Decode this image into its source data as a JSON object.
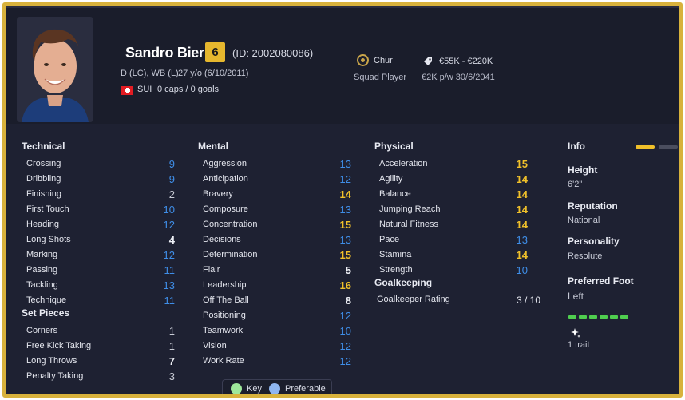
{
  "player": {
    "name": "Sandro Bieri",
    "ca": "6",
    "id_text": "(ID: 2002080086)",
    "positions": "D (LC), WB (L)",
    "age": "27 y/o (6/10/2011)",
    "nationality": "SUI",
    "caps": "0 caps / 0 goals",
    "club": "Chur",
    "squad_status": "Squad Player",
    "value_range": "€55K - €220K",
    "wage_contract": "€2K p/w  30/6/2041"
  },
  "technical": {
    "title": "Technical",
    "items": [
      {
        "label": "Crossing",
        "value": "9",
        "color": "blue"
      },
      {
        "label": "Dribbling",
        "value": "9",
        "color": "blue"
      },
      {
        "label": "Finishing",
        "value": "2",
        "color": "grey"
      },
      {
        "label": "First Touch",
        "value": "10",
        "color": "blue"
      },
      {
        "label": "Heading",
        "value": "12",
        "color": "blue"
      },
      {
        "label": "Long Shots",
        "value": "4",
        "color": "white"
      },
      {
        "label": "Marking",
        "value": "12",
        "color": "blue"
      },
      {
        "label": "Passing",
        "value": "11",
        "color": "blue"
      },
      {
        "label": "Tackling",
        "value": "13",
        "color": "blue"
      },
      {
        "label": "Technique",
        "value": "11",
        "color": "blue"
      }
    ]
  },
  "set_pieces": {
    "title": "Set Pieces",
    "items": [
      {
        "label": "Corners",
        "value": "1",
        "color": "grey"
      },
      {
        "label": "Free Kick Taking",
        "value": "1",
        "color": "grey"
      },
      {
        "label": "Long Throws",
        "value": "7",
        "color": "white"
      },
      {
        "label": "Penalty Taking",
        "value": "3",
        "color": "grey"
      }
    ]
  },
  "mental": {
    "title": "Mental",
    "items": [
      {
        "label": "Aggression",
        "value": "13",
        "color": "blue"
      },
      {
        "label": "Anticipation",
        "value": "12",
        "color": "blue"
      },
      {
        "label": "Bravery",
        "value": "14",
        "color": "yellow"
      },
      {
        "label": "Composure",
        "value": "13",
        "color": "blue"
      },
      {
        "label": "Concentration",
        "value": "15",
        "color": "yellow"
      },
      {
        "label": "Decisions",
        "value": "13",
        "color": "blue"
      },
      {
        "label": "Determination",
        "value": "15",
        "color": "yellow"
      },
      {
        "label": "Flair",
        "value": "5",
        "color": "white"
      },
      {
        "label": "Leadership",
        "value": "16",
        "color": "yellow"
      },
      {
        "label": "Off The Ball",
        "value": "8",
        "color": "white"
      },
      {
        "label": "Positioning",
        "value": "12",
        "color": "blue"
      },
      {
        "label": "Teamwork",
        "value": "10",
        "color": "blue"
      },
      {
        "label": "Vision",
        "value": "12",
        "color": "blue"
      },
      {
        "label": "Work Rate",
        "value": "12",
        "color": "blue"
      }
    ]
  },
  "physical": {
    "title": "Physical",
    "items": [
      {
        "label": "Acceleration",
        "value": "15",
        "color": "yellow"
      },
      {
        "label": "Agility",
        "value": "14",
        "color": "yellow"
      },
      {
        "label": "Balance",
        "value": "14",
        "color": "yellow"
      },
      {
        "label": "Jumping Reach",
        "value": "14",
        "color": "yellow"
      },
      {
        "label": "Natural Fitness",
        "value": "14",
        "color": "yellow"
      },
      {
        "label": "Pace",
        "value": "13",
        "color": "blue"
      },
      {
        "label": "Stamina",
        "value": "14",
        "color": "yellow"
      },
      {
        "label": "Strength",
        "value": "10",
        "color": "blue"
      }
    ]
  },
  "goalkeeping": {
    "title": "Goalkeeping",
    "label": "Goalkeeper Rating",
    "value": "3 / 10"
  },
  "info": {
    "title": "Info",
    "height_label": "Height",
    "height": "6'2\"",
    "reputation_label": "Reputation",
    "reputation": "National",
    "personality_label": "Personality",
    "personality": "Resolute",
    "foot_label": "Preferred Foot",
    "foot": "Left",
    "foot_level": 1.0,
    "traits": "1 trait"
  },
  "legend": {
    "key": "Key",
    "preferable": "Preferable"
  },
  "colors": {
    "border": "#d8b23c",
    "background": "#1e2132",
    "ca_badge": "#e6b72e",
    "attr_blue": "#3f8ee8",
    "attr_yellow": "#f0c02a",
    "key_dot": "#9ee89a",
    "preferable_dot": "#8fb6f0",
    "foot_bar": "#4fce4f"
  },
  "icons": {
    "club": "club-badge-icon",
    "value": "price-tag-icon",
    "trait": "sparkle-icon",
    "flag": "swiss-flag-icon"
  }
}
